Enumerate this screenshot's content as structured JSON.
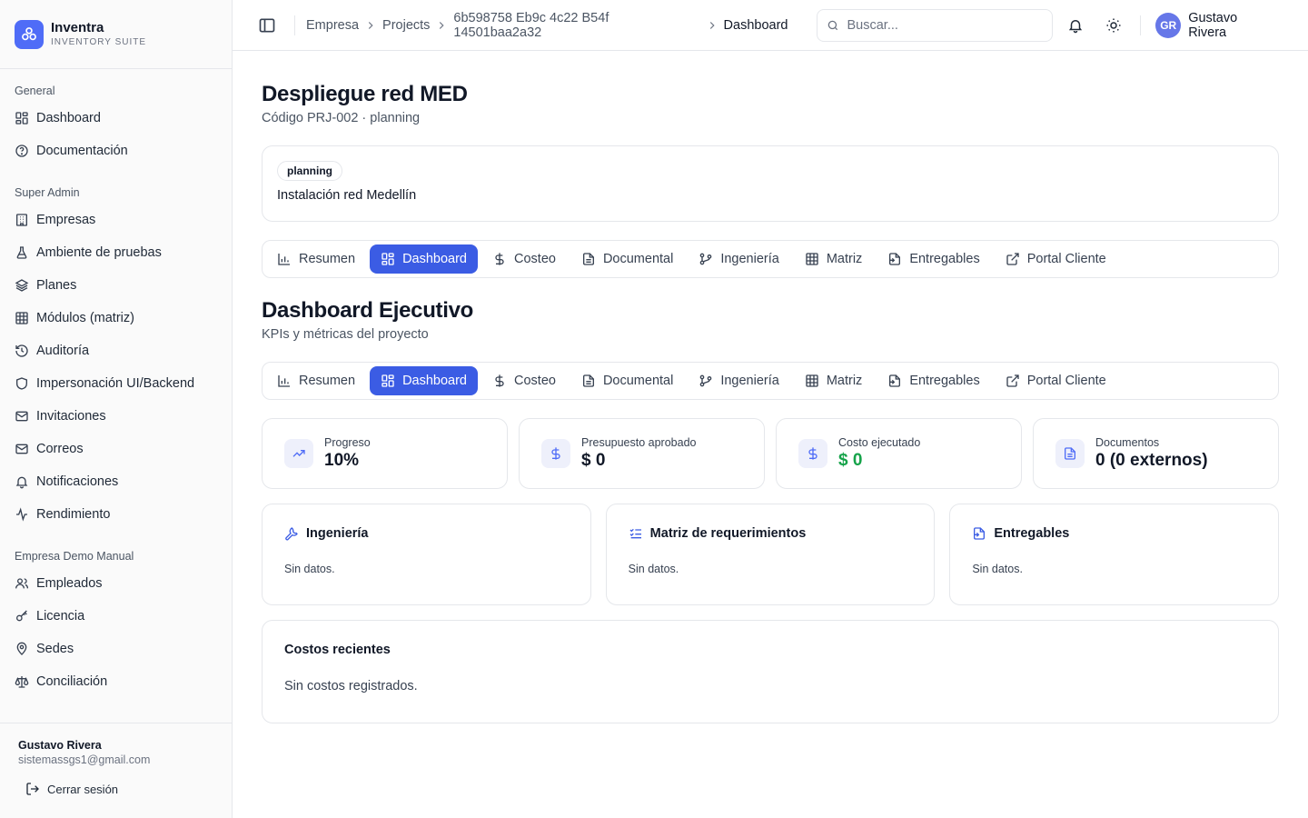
{
  "brand": {
    "name": "Inventra",
    "subtitle": "INVENTORY SUITE"
  },
  "sidebar": {
    "sections": [
      {
        "label": "General",
        "items": [
          {
            "label": "Dashboard",
            "icon": "grid-icon"
          },
          {
            "label": "Documentación",
            "icon": "help-circle-icon"
          }
        ]
      },
      {
        "label": "Super Admin",
        "items": [
          {
            "label": "Empresas",
            "icon": "building-icon"
          },
          {
            "label": "Ambiente de pruebas",
            "icon": "flask-icon"
          },
          {
            "label": "Planes",
            "icon": "layers-icon"
          },
          {
            "label": "Módulos (matriz)",
            "icon": "table-icon"
          },
          {
            "label": "Auditoría",
            "icon": "history-icon"
          },
          {
            "label": "Impersonación UI/Backend",
            "icon": "shield-icon"
          },
          {
            "label": "Invitaciones",
            "icon": "mail-icon"
          },
          {
            "label": "Correos",
            "icon": "mail-icon"
          },
          {
            "label": "Notificaciones",
            "icon": "bell-icon"
          },
          {
            "label": "Rendimiento",
            "icon": "activity-icon"
          }
        ]
      },
      {
        "label": "Empresa Demo Manual",
        "items": [
          {
            "label": "Empleados",
            "icon": "users-icon"
          },
          {
            "label": "Licencia",
            "icon": "key-icon"
          },
          {
            "label": "Sedes",
            "icon": "map-pin-icon"
          },
          {
            "label": "Conciliación",
            "icon": "scale-icon"
          }
        ]
      }
    ],
    "footer": {
      "user_name": "Gustavo Rivera",
      "user_email": "sistemassgs1@gmail.com",
      "logout_label": "Cerrar sesión"
    }
  },
  "header": {
    "breadcrumb": [
      "Empresa",
      "Projects",
      "6b598758 Eb9c 4c22 B54f 14501baa2a32",
      "Dashboard"
    ],
    "search_placeholder": "Buscar...",
    "avatar_initials": "GR",
    "user_name": "Gustavo Rivera"
  },
  "project": {
    "title": "Despliegue red MED",
    "subtitle": "Código PRJ-002 · planning",
    "status_pill": "planning",
    "description": "Instalación red Medellín"
  },
  "tabs": [
    {
      "label": "Resumen",
      "icon": "bar-chart-icon"
    },
    {
      "label": "Dashboard",
      "icon": "grid-icon",
      "active": true
    },
    {
      "label": "Costeo",
      "icon": "dollar-icon"
    },
    {
      "label": "Documental",
      "icon": "file-icon"
    },
    {
      "label": "Ingeniería",
      "icon": "git-branch-icon"
    },
    {
      "label": "Matriz",
      "icon": "table-icon"
    },
    {
      "label": "Entregables",
      "icon": "file-export-icon"
    },
    {
      "label": "Portal Cliente",
      "icon": "external-link-icon"
    }
  ],
  "dashboard": {
    "title": "Dashboard Ejecutivo",
    "subtitle": "KPIs y métricas del proyecto"
  },
  "kpis": [
    {
      "label": "Progreso",
      "value": "10%",
      "icon": "trending-up-icon"
    },
    {
      "label": "Presupuesto aprobado",
      "value": "$ 0",
      "icon": "dollar-icon"
    },
    {
      "label": "Costo ejecutado",
      "value": "$ 0",
      "icon": "dollar-icon",
      "accent": "#16a34a"
    },
    {
      "label": "Documentos",
      "value": "0 (0 externos)",
      "icon": "file-text-icon"
    }
  ],
  "modules": [
    {
      "title": "Ingeniería",
      "empty": "Sin datos.",
      "icon": "wrench-icon"
    },
    {
      "title": "Matriz de requerimientos",
      "empty": "Sin datos.",
      "icon": "list-checks-icon"
    },
    {
      "title": "Entregables",
      "empty": "Sin datos.",
      "icon": "file-export-icon"
    }
  ],
  "costs": {
    "title": "Costos recientes",
    "empty": "Sin costos registrados."
  },
  "colors": {
    "accent": "#3b5ce4",
    "brand": "#4f6cf7",
    "success": "#16a34a"
  }
}
